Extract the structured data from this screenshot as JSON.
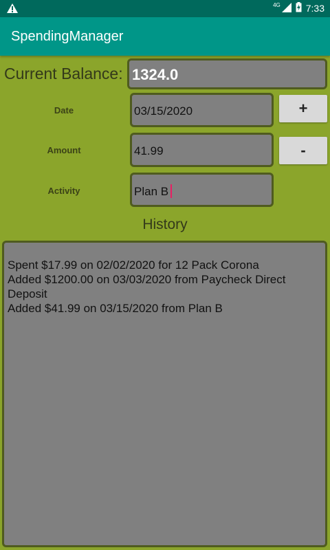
{
  "status_bar": {
    "network": "4G",
    "time": "7:33"
  },
  "app_bar": {
    "title": "SpendingManager"
  },
  "balance": {
    "label": "Current Balance:",
    "value": "1324.0"
  },
  "form": {
    "date_label": "Date",
    "date_value": "03/15/2020",
    "amount_label": "Amount",
    "amount_value": "41.99",
    "activity_label": "Activity",
    "activity_value": "Plan B"
  },
  "buttons": {
    "add_label": "+",
    "subtract_label": "-"
  },
  "history": {
    "title": "History",
    "items": [
      "Spent $17.99 on 02/02/2020 for 12 Pack Corona",
      "Added $1200.00 on 03/03/2020 from Paycheck Direct Deposit",
      "Added $41.99 on 03/15/2020 from Plan B"
    ]
  },
  "colors": {
    "background": "#8ba52b",
    "app_bar": "#009688",
    "status_bar": "#00695c",
    "field": "#808080",
    "caret": "#e91e63"
  }
}
